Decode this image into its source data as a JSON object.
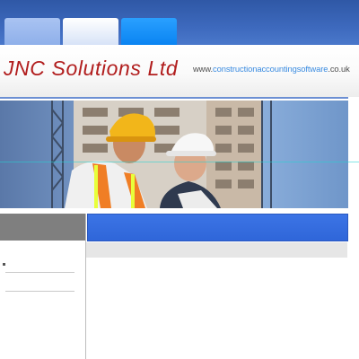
{
  "nav": {
    "tabs": [
      {
        "label": ""
      },
      {
        "label": ""
      },
      {
        "label": ""
      }
    ]
  },
  "header": {
    "logo_text": "JNC Solutions Ltd",
    "url_prefix": "www.",
    "url_accent": "constructionaccountingsoftware",
    "url_suffix": ".co.uk"
  },
  "colors": {
    "brand_red": "#b11d1d",
    "nav_blue": "#2f58a6",
    "accent_blue": "#3a8be0",
    "panel_blue": "#3c74e5",
    "panel_gray": "#7f7f7f"
  },
  "banner": {
    "image_description": ""
  }
}
